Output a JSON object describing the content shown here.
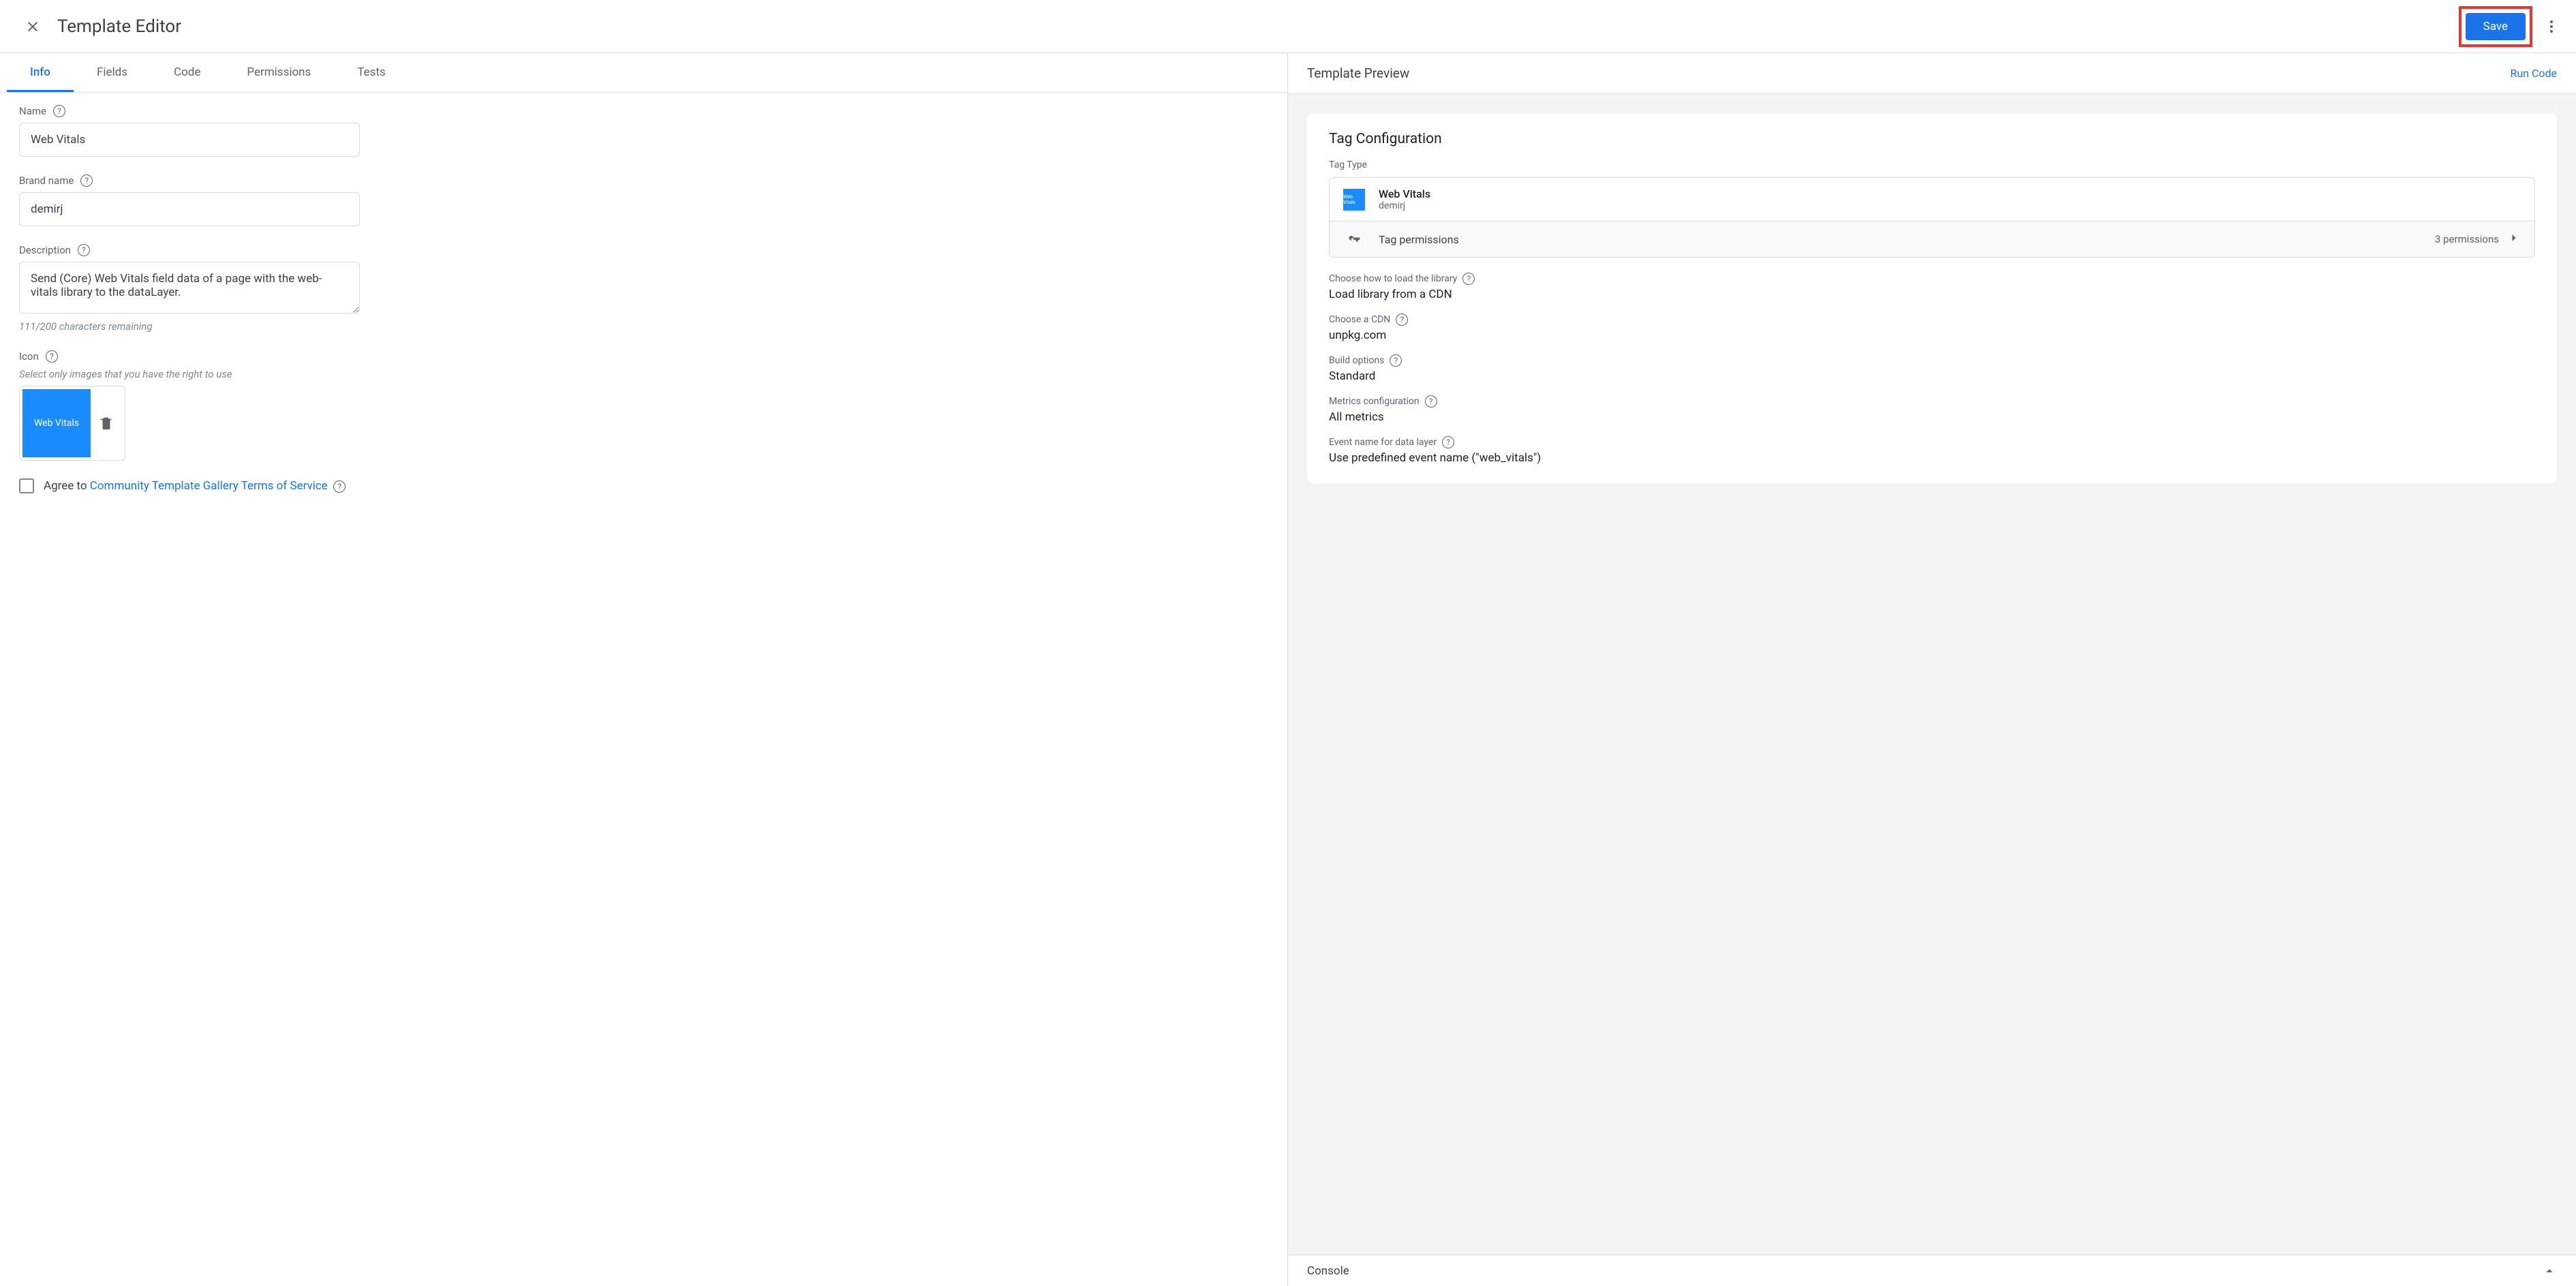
{
  "header": {
    "title": "Template Editor",
    "save_label": "Save"
  },
  "tabs": [
    "Info",
    "Fields",
    "Code",
    "Permissions",
    "Tests"
  ],
  "active_tab": 0,
  "form": {
    "name_label": "Name",
    "name_value": "Web Vitals",
    "brand_label": "Brand name",
    "brand_value": "demirj",
    "desc_label": "Description",
    "desc_value": "Send (Core) Web Vitals field data of a page with the web-vitals library to the dataLayer.",
    "desc_counter": "111/200 characters remaining",
    "icon_label": "Icon",
    "icon_note": "Select only images that you have the right to use",
    "icon_thumb_text": "Web Vitals",
    "agree_prefix": "Agree to ",
    "agree_link": "Community Template Gallery Terms of Service"
  },
  "preview": {
    "title": "Template Preview",
    "run_code": "Run Code",
    "card_title": "Tag Configuration",
    "tagtype_label": "Tag Type",
    "type_name": "Web Vitals",
    "type_sub": "demirj",
    "type_icon_text": "Web Vitals",
    "perm_label": "Tag permissions",
    "perm_count": "3 permissions",
    "settings": [
      {
        "label": "Choose how to load the library",
        "value": "Load library from a CDN",
        "help": true
      },
      {
        "label": "Choose a CDN",
        "value": "unpkg.com",
        "help": true
      },
      {
        "label": "Build options",
        "value": "Standard",
        "help": true
      },
      {
        "label": "Metrics configuration",
        "value": "All metrics",
        "help": true
      },
      {
        "label": "Event name for data layer",
        "value": "Use predefined event name (\"web_vitals\")",
        "help": true
      }
    ]
  },
  "console": {
    "title": "Console"
  }
}
